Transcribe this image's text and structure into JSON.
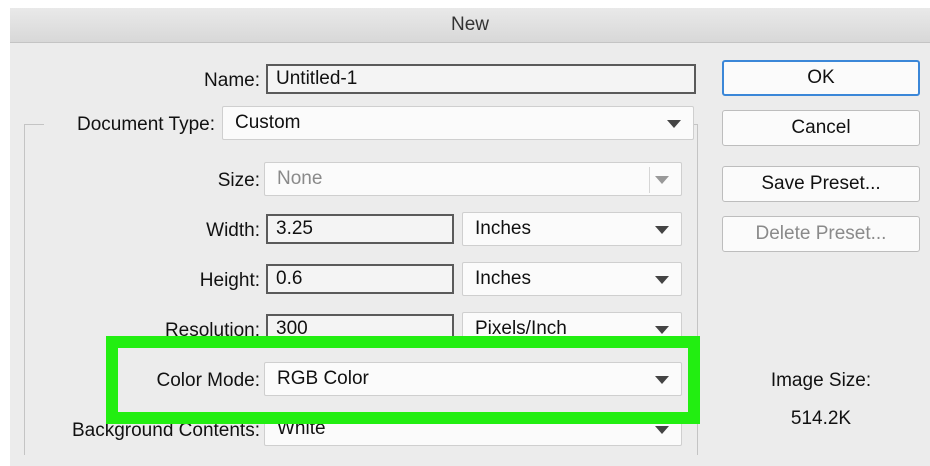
{
  "dialog": {
    "title": "New"
  },
  "form": {
    "name": {
      "label": "Name:",
      "value": "Untitled-1"
    },
    "document_type": {
      "label": "Document Type:",
      "value": "Custom"
    },
    "size": {
      "label": "Size:",
      "value": "None"
    },
    "width": {
      "label": "Width:",
      "value": "3.25",
      "unit": "Inches"
    },
    "height": {
      "label": "Height:",
      "value": "0.6",
      "unit": "Inches"
    },
    "resolution": {
      "label": "Resolution:",
      "value": "300",
      "unit": "Pixels/Inch"
    },
    "color_mode": {
      "label": "Color Mode:",
      "value": "RGB Color"
    },
    "background_contents": {
      "label": "Background Contents:",
      "value": "White"
    }
  },
  "buttons": {
    "ok": "OK",
    "cancel": "Cancel",
    "save_preset": "Save Preset...",
    "delete_preset": "Delete Preset..."
  },
  "image_size": {
    "label": "Image Size:",
    "value": "514.2K"
  },
  "highlight": {
    "color": "#22ee11",
    "target": "color-mode-row"
  }
}
